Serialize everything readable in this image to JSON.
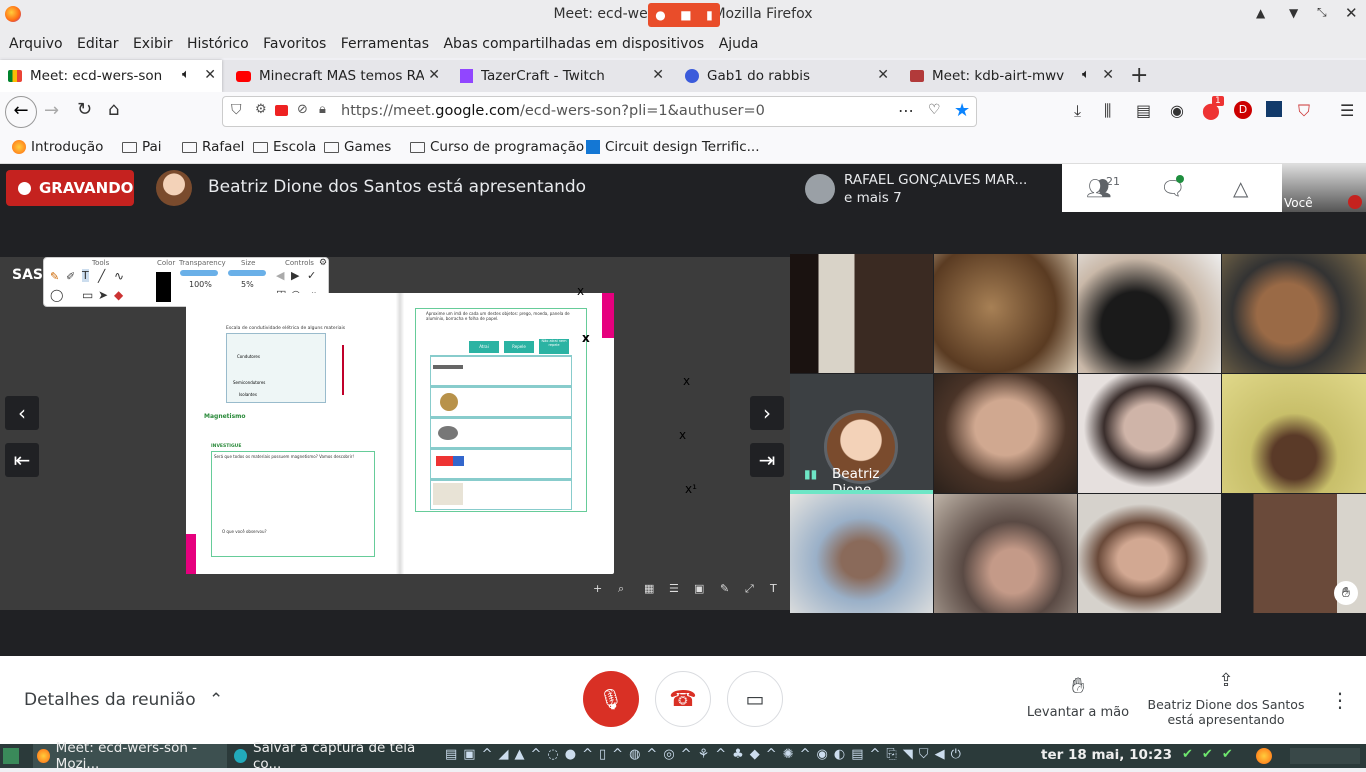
{
  "window": {
    "title": "Meet: ecd-wers-son — Mozilla Firefox"
  },
  "menu": [
    "Arquivo",
    "Editar",
    "Exibir",
    "Histórico",
    "Favoritos",
    "Ferramentas",
    "Abas compartilhadas em dispositivos",
    "Ajuda"
  ],
  "tabs": [
    {
      "label": "Meet: ecd-wers-son",
      "icon": "google-meet-icon",
      "active": true
    },
    {
      "label": "Minecraft MAS temos RAÇ",
      "icon": "youtube-icon"
    },
    {
      "label": "TazerCraft - Twitch",
      "icon": "twitch-icon"
    },
    {
      "label": "Gab1 do rabbis",
      "icon": "tab-icon"
    },
    {
      "label": "Meet: kdb-airt-mwv",
      "icon": "google-meet-icon"
    }
  ],
  "url": {
    "prefix": "https://meet.",
    "domain": "google.com",
    "path": "/ecd-wers-son?pli=1&authuser=0"
  },
  "bookmarks": [
    {
      "label": "Introdução",
      "icon": "firefox-icon"
    },
    {
      "label": "Pai",
      "icon": "folder-icon"
    },
    {
      "label": "Rafael",
      "icon": "folder-icon"
    },
    {
      "label": "Escola",
      "icon": "folder-icon"
    },
    {
      "label": "Games",
      "icon": "folder-icon"
    },
    {
      "label": "Curso de programação",
      "icon": "folder-icon"
    },
    {
      "label": "Circuit design Terrific...",
      "icon": "tinkercad-icon"
    }
  ],
  "toolbar_badge": "1",
  "meet": {
    "recording": "GRAVANDO",
    "presenting_text": "Beatriz Dione dos Santos está apresentando",
    "participant_name": "RAFAEL GONÇALVES MAR...",
    "participant_more": "e mais 7",
    "people_count": "21",
    "self_label": "Você",
    "presenter_tile_name": "Beatriz Dione...",
    "meeting_details": "Detalhes da reunião",
    "raise_hand": "Levantar a mão",
    "presenting_btn_line1": "Beatriz Dione dos Santos",
    "presenting_btn_line2": "está apresentando"
  },
  "slide_tools": {
    "tools_label": "Tools",
    "color_label": "Color",
    "transparency_label": "Transparency",
    "transparency_value": "100%",
    "size_label": "Size",
    "size_value": "5%",
    "controls_label": "Controls",
    "brand": "SAS"
  },
  "slide": {
    "left_title": "Escala de condutividade elétrica de alguns materiais",
    "magnetism": "Magnetismo",
    "investigate": "INVESTIGUE",
    "question": "Será que todos os materiais possuem magnetismo? Vamos descobrir!",
    "observe": "O que você observou?",
    "right_intro": "Aproxime um ímã de cada um destes objetos: prego, moeda, panela de alumínio, borracha e folha de papel.",
    "table_headers": [
      "Atrai",
      "Repele",
      "Não atrai nem repele"
    ],
    "marks": [
      "x",
      "x",
      "x",
      "x",
      "x¹"
    ],
    "conductors": "Condutores",
    "semiconductors": "Semicondutores",
    "insulators": "Isolantes"
  },
  "taskbar": {
    "items": [
      "Meet: ecd-wers-son - Mozi...",
      "Salvar a captura de tela co..."
    ],
    "clock": "ter 18 mai, 10:23"
  }
}
